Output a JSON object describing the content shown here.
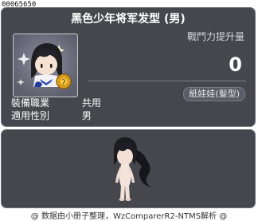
{
  "item": {
    "id": "00065650",
    "name": "黑色少年将军发型 (男)",
    "icon": "hairstyle-character-icon"
  },
  "stat": {
    "label": "戰鬥力提升量",
    "value": "0"
  },
  "category": "紙娃娃(髮型)",
  "properties": [
    {
      "key": "裝備職業",
      "value": "共用"
    },
    {
      "key": "適用性別",
      "value": "男"
    }
  ],
  "preview": {
    "icon": "character-preview-figure"
  },
  "footer": "@ 数据由小册子整理，WzComparerR2-NTMS解析 @",
  "colors": {
    "panel_bg": "#45474d",
    "panel_border": "#6d717a",
    "text": "#ffffff"
  }
}
